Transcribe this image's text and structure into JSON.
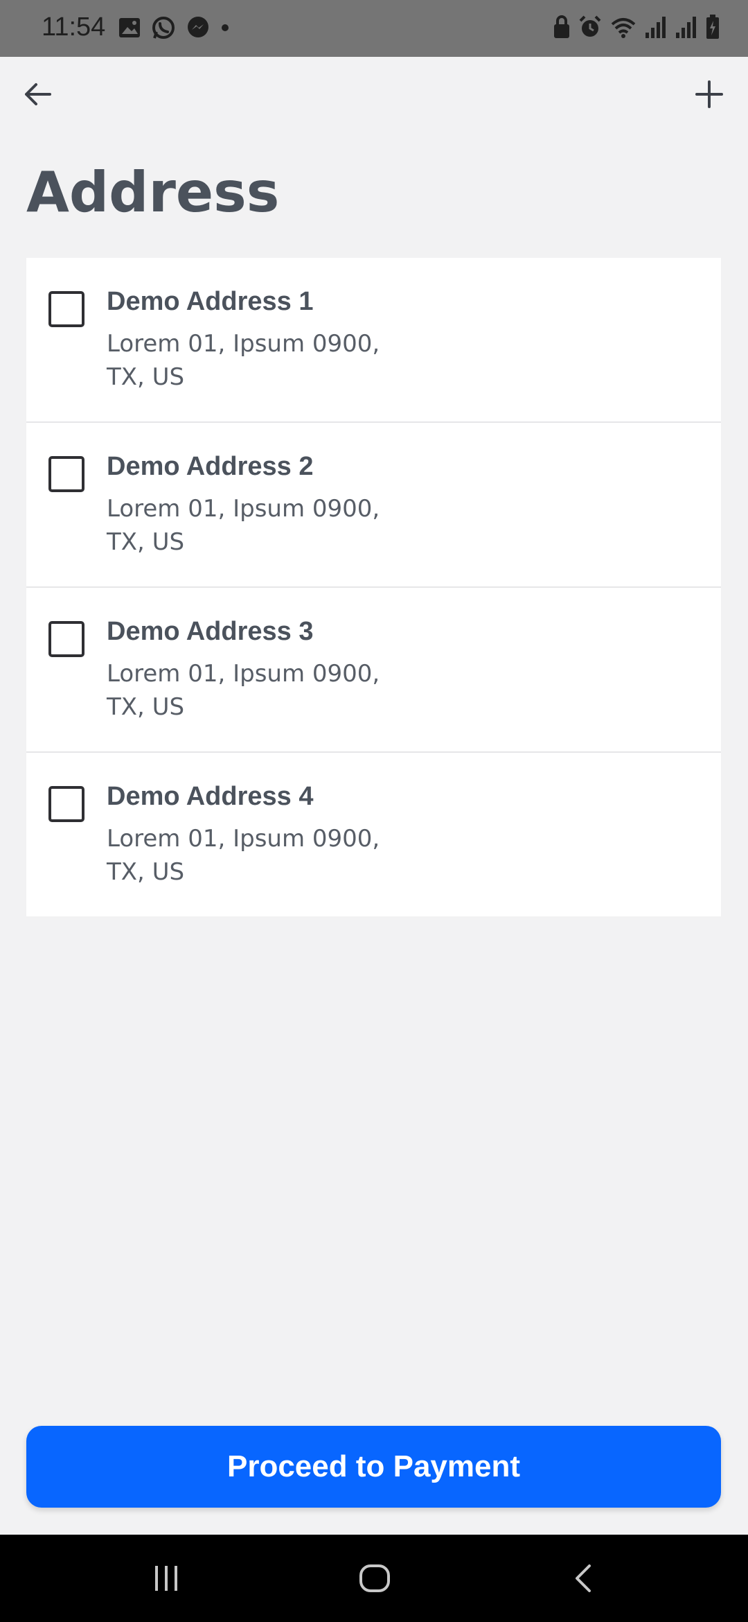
{
  "status_bar": {
    "time": "11:54",
    "left_icons": [
      "image-icon",
      "whatsapp-icon",
      "messenger-icon",
      "dot-icon"
    ],
    "right_icons": [
      "lock-icon",
      "alarm-icon",
      "wifi-icon",
      "signal-icon",
      "signal-icon",
      "battery-charging-icon"
    ]
  },
  "app_bar": {
    "back_icon": "arrow-left-icon",
    "add_icon": "plus-icon"
  },
  "page": {
    "title": "Address"
  },
  "addresses": [
    {
      "name": "Demo Address 1",
      "line1": "Lorem 01, Ipsum 0900,",
      "line2": "TX, US",
      "checked": false
    },
    {
      "name": "Demo Address 2",
      "line1": "Lorem 01, Ipsum 0900,",
      "line2": "TX, US",
      "checked": false
    },
    {
      "name": "Demo Address 3",
      "line1": "Lorem 01, Ipsum 0900,",
      "line2": "TX, US",
      "checked": false
    },
    {
      "name": "Demo Address 4",
      "line1": "Lorem 01, Ipsum 0900,",
      "line2": "TX, US",
      "checked": false
    }
  ],
  "actions": {
    "proceed_label": "Proceed to Payment"
  },
  "nav_bar": {
    "icons": [
      "recent-apps-icon",
      "home-icon",
      "back-icon"
    ]
  },
  "colors": {
    "accent": "#0866ff",
    "background": "#f2f2f3",
    "title_text": "#4b525c",
    "status_bar": "#757575"
  }
}
